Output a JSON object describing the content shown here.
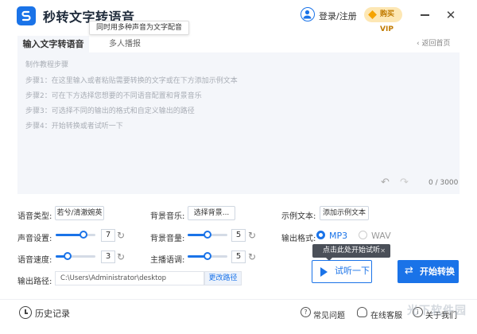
{
  "header": {
    "app_title": "秒转文字转语音",
    "tooltip": "同时用多种声音为文字配音",
    "login_label": "登录/注册",
    "vip_label": "购买VIP",
    "close_glyph": "✕"
  },
  "tabs": [
    {
      "label": "输入文字转语音",
      "active": true
    },
    {
      "label": "多人播报",
      "active": false
    }
  ],
  "back_link": "‹ 返回首页",
  "editor": {
    "hints": [
      "制作教程步骤",
      "步骤1：在这里输入或者粘贴需要转换的文字或在下方添加示例文本",
      "步骤2：可在下方选择您想要的不同语音配置和背景音乐",
      "步骤3：可选择不同的输出的格式和自定义输出的路径",
      "步骤4：开始转换或者试听一下"
    ],
    "char_count": "0 / 3000",
    "undo_glyph": "↶",
    "redo_glyph": "↷"
  },
  "controls": {
    "voice_type_label": "语音类型:",
    "voice_type_value": "若兮/清澈婉英",
    "bg_music_label": "背景音乐:",
    "bg_music_button": "选择背景...",
    "sample_text_label": "示例文本:",
    "sample_text_button": "添加示例文本",
    "volume_label": "声音设置:",
    "volume_value": "7",
    "volume_level": 0.7,
    "bg_volume_label": "背景音量:",
    "bg_volume_value": "5",
    "bg_volume_level": 0.5,
    "output_format_label": "输出格式:",
    "format_options": [
      "MP3",
      "WAV"
    ],
    "format_selected": "MP3",
    "speed_label": "语音速度:",
    "speed_value": "3",
    "speed_level": 0.3,
    "pitch_label": "主播语调:",
    "pitch_value": "5",
    "pitch_level": 0.5,
    "reset_glyph": "↻",
    "path_label": "输出路径:",
    "path_value": "C:\\Users\\Administrator\\desktop",
    "change_path_button": "更改路径",
    "start_tip": "点击此处开始试听",
    "tip_close": "✕",
    "listen_button": "试听一下",
    "convert_button": "开始转换",
    "convert_glyph": "⇄"
  },
  "footer": {
    "history_label": "历史记录",
    "faq_label": "常见问题",
    "support_label": "在线客服",
    "about_label": "关于我们",
    "watermark": "光下软件园"
  },
  "colors": {
    "accent": "#1a73e8",
    "editor_bg": "#f4f6fa",
    "vip_bg": "#fde7b4"
  }
}
